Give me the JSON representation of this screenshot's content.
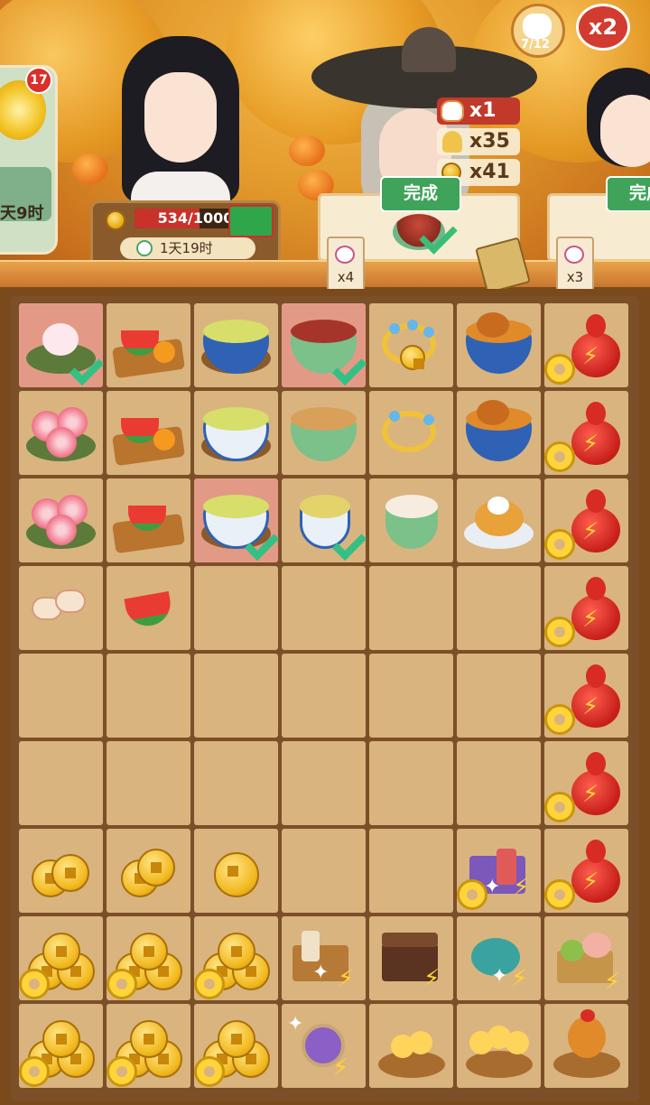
{
  "top": {
    "side_order": {
      "badge_count": "17",
      "timer_text": "天9时"
    },
    "lady": {
      "progress_text": "534/1000",
      "progress_value": 534,
      "progress_max": 1000,
      "timer_text": "1天19时"
    },
    "order_center": {
      "complete_label": "完成",
      "rewards": [
        {
          "icon": "cat-token-icon",
          "text": "x1"
        },
        {
          "icon": "wheat-icon",
          "text": "x35"
        },
        {
          "icon": "coin-icon",
          "text": "x41"
        }
      ]
    },
    "order_right": {
      "complete_label": "完成"
    },
    "tags": [
      {
        "text": "x4"
      },
      {
        "text": "x3"
      }
    ],
    "avatar_count": "7/12",
    "multiplier": "x2"
  },
  "colors": {
    "complete_green": "#3fa35a",
    "highlight_cell": "#e29a86",
    "board_cell": "#d9b47f",
    "accent_red": "#d23b2f"
  }
}
